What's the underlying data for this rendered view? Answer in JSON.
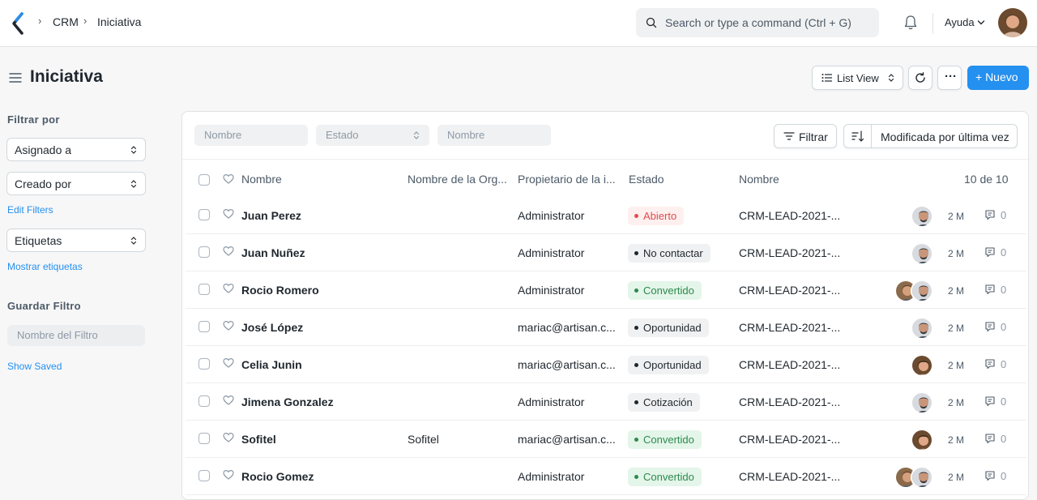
{
  "navbar": {
    "breadcrumbs": [
      "CRM",
      "Iniciativa"
    ],
    "search_placeholder": "Search or type a command (Ctrl + G)",
    "help_label": "Ayuda"
  },
  "page": {
    "title": "Iniciativa",
    "list_view_label": "List View",
    "more_label": "···",
    "new_label": "+ Nuevo"
  },
  "sidebar": {
    "filter_by_label": "Filtrar por",
    "assigned_to": "Asignado a",
    "created_by": "Creado por",
    "edit_filters": "Edit Filters",
    "tags": "Etiquetas",
    "show_tags": "Mostrar etiquetas",
    "save_filter_label": "Guardar Filtro",
    "filter_name_placeholder": "Nombre del Filtro",
    "show_saved": "Show Saved"
  },
  "filters": {
    "name_placeholder": "Nombre",
    "status_placeholder": "Estado",
    "name2_placeholder": "Nombre",
    "filter_button": "Filtrar",
    "sort_label": "Modificada por última vez"
  },
  "table": {
    "headers": {
      "name": "Nombre",
      "org": "Nombre de la Org...",
      "owner": "Propietario de la i...",
      "status": "Estado",
      "code": "Nombre",
      "count": "10 de 10"
    },
    "rows": [
      {
        "name": "Juan Perez",
        "org": "",
        "owner": "Administrator",
        "status": "Abierto",
        "status_type": "open",
        "code": "CRM-LEAD-2021-...",
        "avatars": [
          "man"
        ],
        "modified": "2 M",
        "comments": "0"
      },
      {
        "name": "Juan Nuñez",
        "org": "",
        "owner": "Administrator",
        "status": "No contactar",
        "status_type": "gray",
        "code": "CRM-LEAD-2021-...",
        "avatars": [
          "man"
        ],
        "modified": "2 M",
        "comments": "0"
      },
      {
        "name": "Rocio Romero",
        "org": "",
        "owner": "Administrator",
        "status": "Convertido",
        "status_type": "green",
        "code": "CRM-LEAD-2021-...",
        "avatars": [
          "man2",
          "man"
        ],
        "modified": "2 M",
        "comments": "0"
      },
      {
        "name": "José López",
        "org": "",
        "owner": "mariac@artisan.c...",
        "status": "Oportunidad",
        "status_type": "gray",
        "code": "CRM-LEAD-2021-...",
        "avatars": [
          "man"
        ],
        "modified": "2 M",
        "comments": "0"
      },
      {
        "name": "Celia Junin",
        "org": "",
        "owner": "mariac@artisan.c...",
        "status": "Oportunidad",
        "status_type": "gray",
        "code": "CRM-LEAD-2021-...",
        "avatars": [
          "woman"
        ],
        "modified": "2 M",
        "comments": "0"
      },
      {
        "name": "Jimena Gonzalez",
        "org": "",
        "owner": "Administrator",
        "status": "Cotización",
        "status_type": "gray",
        "code": "CRM-LEAD-2021-...",
        "avatars": [
          "man"
        ],
        "modified": "2 M",
        "comments": "0"
      },
      {
        "name": "Sofitel",
        "org": "Sofitel",
        "owner": "mariac@artisan.c...",
        "status": "Convertido",
        "status_type": "green",
        "code": "CRM-LEAD-2021-...",
        "avatars": [
          "woman"
        ],
        "modified": "2 M",
        "comments": "0"
      },
      {
        "name": "Rocio Gomez",
        "org": "",
        "owner": "Administrator",
        "status": "Convertido",
        "status_type": "green",
        "code": "CRM-LEAD-2021-...",
        "avatars": [
          "man2",
          "man"
        ],
        "modified": "2 M",
        "comments": "0"
      }
    ]
  },
  "colors": {
    "primary": "#2490ef",
    "status_open_bg": "#fff0f0",
    "status_open_fg": "#e24c4c",
    "status_green_bg": "#e4f5e9",
    "status_green_fg": "#2d8a4e",
    "status_gray_bg": "#f0f1f2",
    "status_gray_fg": "#1f272e"
  }
}
